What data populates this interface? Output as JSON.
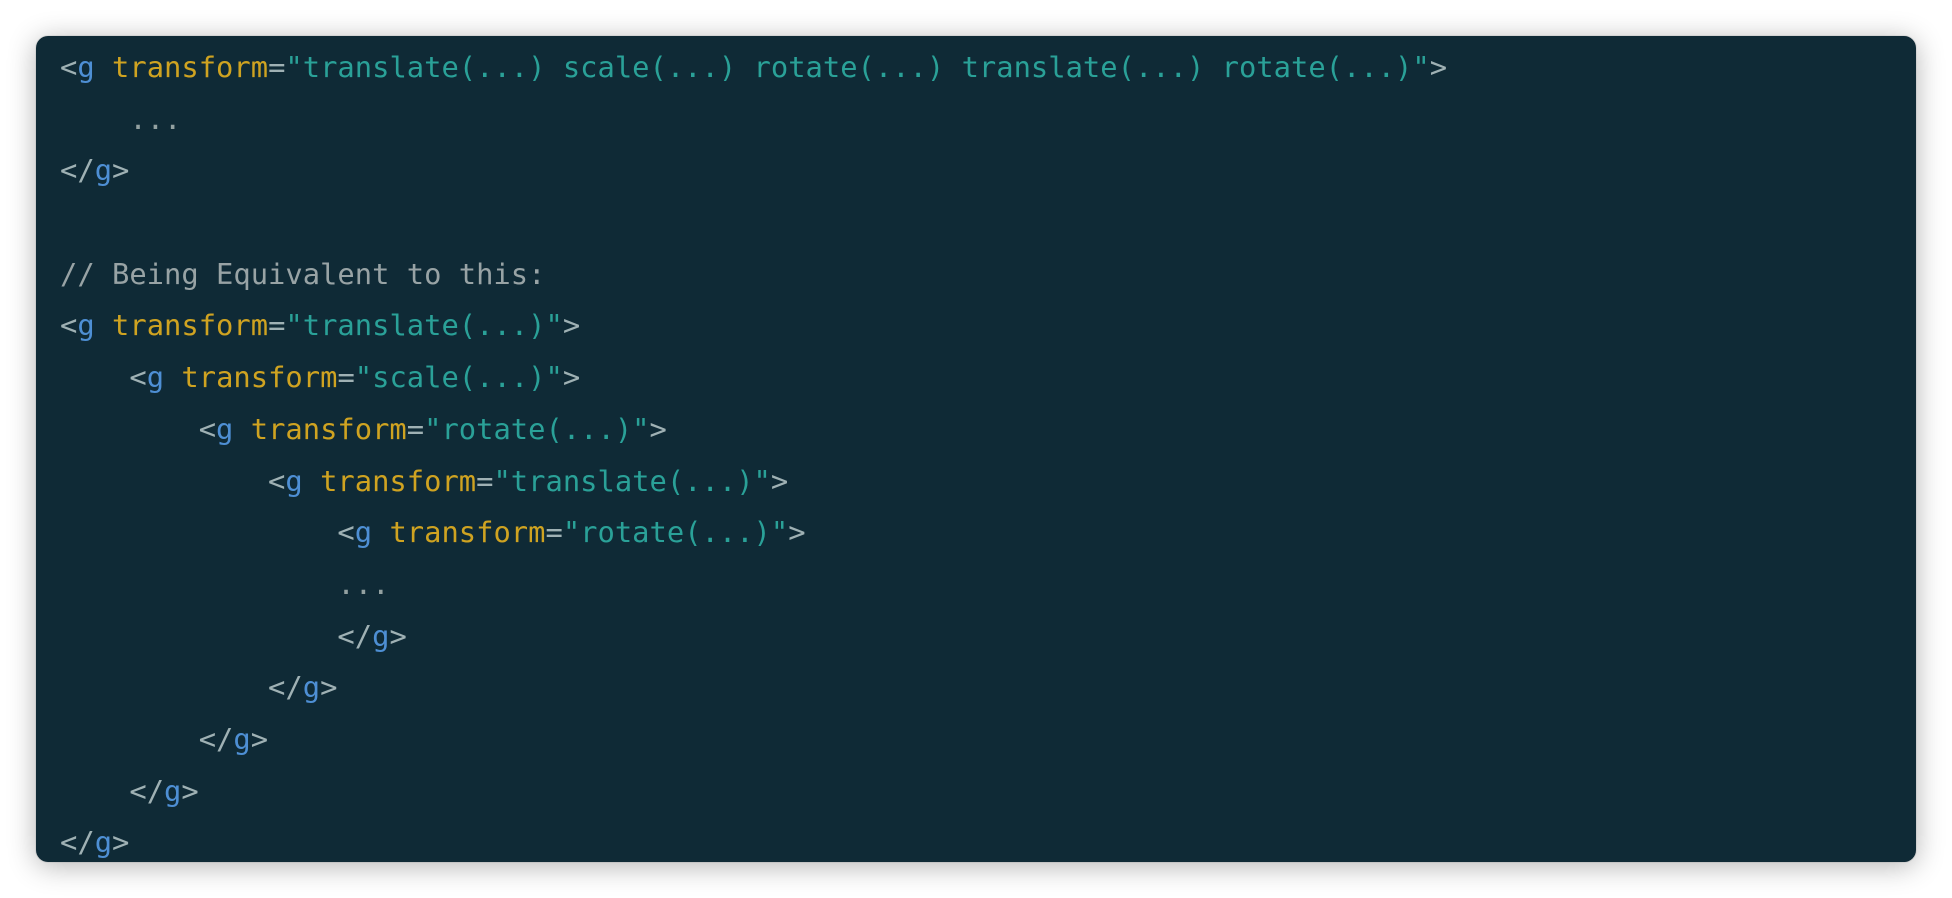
{
  "colors": {
    "background": "#0f2a36",
    "punctuation": "#9fb1b4",
    "tag": "#4e8fd4",
    "attribute": "#cfa321",
    "string": "#2aa198",
    "comment": "#98a3a5"
  },
  "code": {
    "lines": [
      {
        "indent": "",
        "tokens": [
          [
            "punct",
            "<"
          ],
          [
            "tag",
            "g"
          ],
          [
            "punct",
            " "
          ],
          [
            "attr",
            "transform"
          ],
          [
            "punct",
            "="
          ],
          [
            "str",
            "\"translate(...) scale(...) rotate(...) translate(...) rotate(...)\""
          ],
          [
            "punct",
            ">"
          ]
        ]
      },
      {
        "indent": "    ",
        "tokens": [
          [
            "ellipsis",
            "..."
          ]
        ]
      },
      {
        "indent": "",
        "tokens": [
          [
            "punct",
            "</"
          ],
          [
            "tag",
            "g"
          ],
          [
            "punct",
            ">"
          ]
        ]
      },
      {
        "indent": "",
        "tokens": []
      },
      {
        "indent": "",
        "tokens": [
          [
            "comment",
            "// Being Equivalent to this:"
          ]
        ]
      },
      {
        "indent": "",
        "tokens": [
          [
            "punct",
            "<"
          ],
          [
            "tag",
            "g"
          ],
          [
            "punct",
            " "
          ],
          [
            "attr",
            "transform"
          ],
          [
            "punct",
            "="
          ],
          [
            "str",
            "\"translate(...)\""
          ],
          [
            "punct",
            ">"
          ]
        ]
      },
      {
        "indent": "    ",
        "tokens": [
          [
            "punct",
            "<"
          ],
          [
            "tag",
            "g"
          ],
          [
            "punct",
            " "
          ],
          [
            "attr",
            "transform"
          ],
          [
            "punct",
            "="
          ],
          [
            "str",
            "\"scale(...)\""
          ],
          [
            "punct",
            ">"
          ]
        ]
      },
      {
        "indent": "        ",
        "tokens": [
          [
            "punct",
            "<"
          ],
          [
            "tag",
            "g"
          ],
          [
            "punct",
            " "
          ],
          [
            "attr",
            "transform"
          ],
          [
            "punct",
            "="
          ],
          [
            "str",
            "\"rotate(...)\""
          ],
          [
            "punct",
            ">"
          ]
        ]
      },
      {
        "indent": "            ",
        "tokens": [
          [
            "punct",
            "<"
          ],
          [
            "tag",
            "g"
          ],
          [
            "punct",
            " "
          ],
          [
            "attr",
            "transform"
          ],
          [
            "punct",
            "="
          ],
          [
            "str",
            "\"translate(...)\""
          ],
          [
            "punct",
            ">"
          ]
        ]
      },
      {
        "indent": "                ",
        "tokens": [
          [
            "punct",
            "<"
          ],
          [
            "tag",
            "g"
          ],
          [
            "punct",
            " "
          ],
          [
            "attr",
            "transform"
          ],
          [
            "punct",
            "="
          ],
          [
            "str",
            "\"rotate(...)\""
          ],
          [
            "punct",
            ">"
          ]
        ]
      },
      {
        "indent": "                ",
        "tokens": [
          [
            "ellipsis",
            "..."
          ]
        ]
      },
      {
        "indent": "                ",
        "tokens": [
          [
            "punct",
            "</"
          ],
          [
            "tag",
            "g"
          ],
          [
            "punct",
            ">"
          ]
        ]
      },
      {
        "indent": "            ",
        "tokens": [
          [
            "punct",
            "</"
          ],
          [
            "tag",
            "g"
          ],
          [
            "punct",
            ">"
          ]
        ]
      },
      {
        "indent": "        ",
        "tokens": [
          [
            "punct",
            "</"
          ],
          [
            "tag",
            "g"
          ],
          [
            "punct",
            ">"
          ]
        ]
      },
      {
        "indent": "    ",
        "tokens": [
          [
            "punct",
            "</"
          ],
          [
            "tag",
            "g"
          ],
          [
            "punct",
            ">"
          ]
        ]
      },
      {
        "indent": "",
        "tokens": [
          [
            "punct",
            "</"
          ],
          [
            "tag",
            "g"
          ],
          [
            "punct",
            ">"
          ]
        ]
      }
    ]
  }
}
